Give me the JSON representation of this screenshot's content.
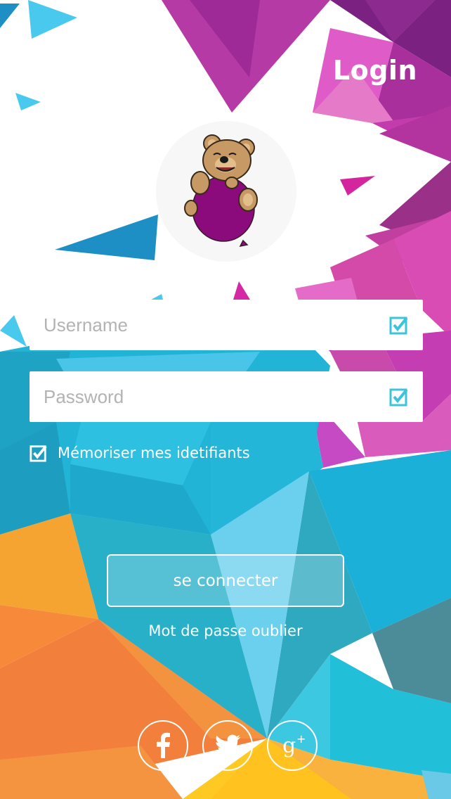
{
  "header": {
    "title": "Login"
  },
  "form": {
    "username": {
      "placeholder": "Username",
      "value": ""
    },
    "password": {
      "placeholder": "Password",
      "value": ""
    },
    "remember_label": "Mémoriser mes idetifiants",
    "remember_checked": true,
    "submit_label": "se connecter",
    "forgot_label": "Mot de passe oublier"
  },
  "social": [
    {
      "icon": "facebook-icon"
    },
    {
      "icon": "twitter-icon"
    },
    {
      "icon": "google-plus-icon"
    }
  ],
  "colors": {
    "accent": "#3cc4d8",
    "magenta": "#c233b4",
    "orange": "#f5a030",
    "input_bg": "#ffffff"
  }
}
